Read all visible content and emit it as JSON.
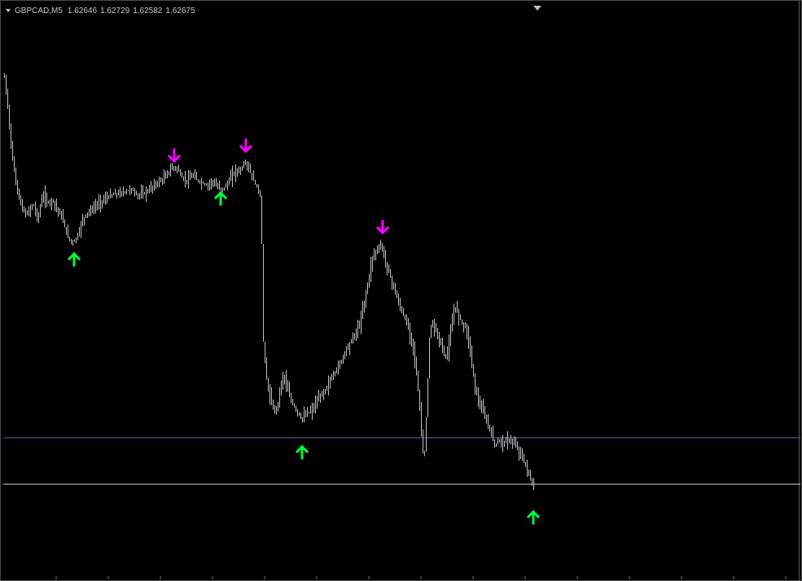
{
  "window": {
    "symbol": "GBPCAD,M5",
    "open": "1.62646",
    "high": "1.62729",
    "low": "1.62582",
    "close": "1.62675"
  },
  "colors": {
    "background": "#000000",
    "bars": "#c0c0c0",
    "buy_arrow": "#00ff3c",
    "sell_arrow": "#ff00ff",
    "level_upper": "#4f6f98",
    "level_lower": "#cfcfcf"
  },
  "signals": {
    "sell": [
      "down-arrow-1",
      "down-arrow-2",
      "down-arrow-3"
    ],
    "buy": [
      "up-arrow-1",
      "up-arrow-2",
      "up-arrow-3",
      "up-arrow-4"
    ]
  }
}
